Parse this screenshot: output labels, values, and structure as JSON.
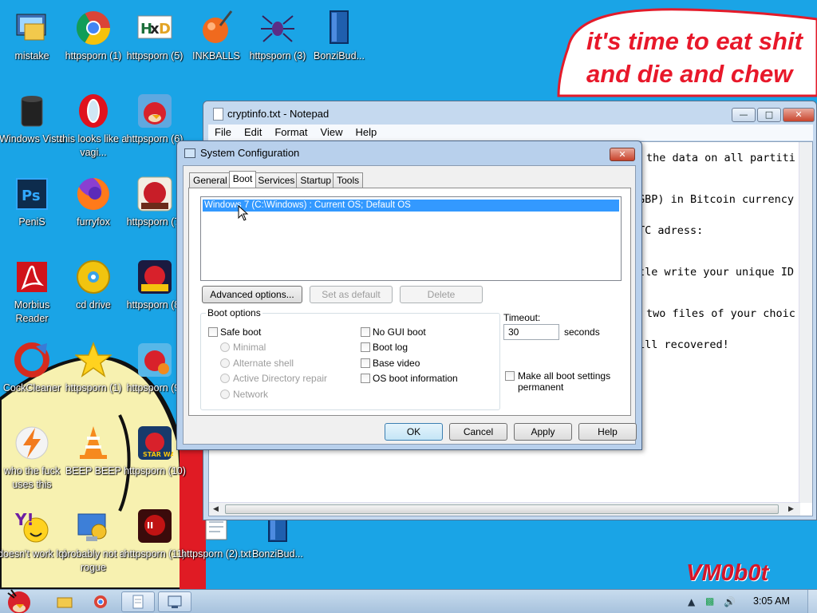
{
  "wallpaper": {
    "line1": "it's time to eat shit",
    "line2": "and die and chew",
    "watermark": "VM0b0t"
  },
  "desktop_icons": [
    {
      "label": "mistake",
      "icon": "monitor-folder-icon"
    },
    {
      "label": "httpsporn (1)",
      "icon": "chrome-icon"
    },
    {
      "label": "httpsporn (5)",
      "icon": "hxd-icon"
    },
    {
      "label": "INKBALLS",
      "icon": "inkball-icon"
    },
    {
      "label": "httpsporn (3)",
      "icon": "spider-solitaire-icon"
    },
    {
      "label": "BonziBud...",
      "icon": "book-icon"
    },
    {
      "label": "Windows Vista",
      "icon": "recycle-bin-icon"
    },
    {
      "label": "this looks like a vagi...",
      "icon": "opera-icon"
    },
    {
      "label": "httpsporn (6)",
      "icon": "angry-birds-icon"
    },
    {
      "label": "PeniS",
      "icon": "photoshop-icon"
    },
    {
      "label": "furryfox",
      "icon": "firefox-icon"
    },
    {
      "label": "httpsporn (7)",
      "icon": "angry-birds-seasons-icon"
    },
    {
      "label": "Morbius Reader",
      "icon": "acrobat-reader-icon"
    },
    {
      "label": "cd drive",
      "icon": "cd-drive-icon"
    },
    {
      "label": "httpsporn (8)",
      "icon": "angry-birds-space-icon"
    },
    {
      "label": "CockCleaner",
      "icon": "ccleaner-icon"
    },
    {
      "label": "httpsporn (1)",
      "icon": "star-icon"
    },
    {
      "label": "httpsporn (9)",
      "icon": "angry-birds-rio-icon"
    },
    {
      "label": "who the fuck uses this",
      "icon": "winamp-icon"
    },
    {
      "label": "BEEP BEEP",
      "icon": "vlc-icon"
    },
    {
      "label": "httpsporn (10)",
      "icon": "angry-birds-star-wars-icon"
    },
    {
      "label": "doesn't work lol",
      "icon": "yahoo-messenger-icon"
    },
    {
      "label": "probably not a rogue",
      "icon": "control-panel-icon"
    },
    {
      "label": "httpsporn (11)",
      "icon": "angry-birds-star-wars-2-icon"
    },
    {
      "label": "httpsporn (2).txt",
      "icon": "text-file-icon"
    },
    {
      "label": "BonziBud...",
      "icon": "book-icon"
    }
  ],
  "notepad": {
    "title": "cryptinfo.txt - Notepad",
    "menu": [
      "File",
      "Edit",
      "Format",
      "View",
      "Help"
    ],
    "lines": [
      "the data on all partiti",
      "GBP) in Bitcoin currency",
      "TC adress:",
      "tle write your unique ID",
      "two files of your choic",
      "ill recovered!"
    ]
  },
  "msconfig": {
    "title": "System Configuration",
    "tabs": [
      "General",
      "Boot",
      "Services",
      "Startup",
      "Tools"
    ],
    "active_tab": "Boot",
    "os_entry": "Windows 7 (C:\\Windows) : Current OS; Default OS",
    "buttons": {
      "advanced": "Advanced options...",
      "set_default": "Set as default",
      "delete": "Delete",
      "ok": "OK",
      "cancel": "Cancel",
      "apply": "Apply",
      "help": "Help"
    },
    "boot_options_label": "Boot options",
    "safe_boot": "Safe boot",
    "radios": [
      "Minimal",
      "Alternate shell",
      "Active Directory repair",
      "Network"
    ],
    "right_checks": [
      "No GUI boot",
      "Boot log",
      "Base video",
      "OS boot information"
    ],
    "timeout_label": "Timeout:",
    "timeout_value": "30",
    "timeout_unit": "seconds",
    "make_permanent": "Make all boot settings permanent"
  },
  "taskbar": {
    "clock": "3:05 AM",
    "items": [
      "explorer-icon",
      "chrome-icon",
      "notepad-icon",
      "system-configuration-icon"
    ]
  }
}
